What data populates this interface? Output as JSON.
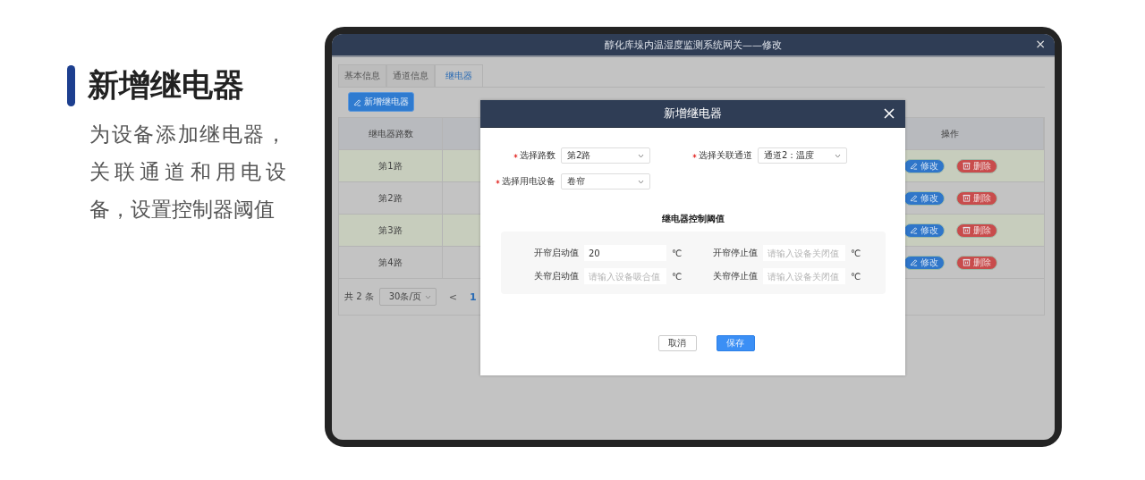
{
  "slide": {
    "title": "新增继电器",
    "description": "为设备添加继电器，关联通道和用电设备，设置控制器阈值"
  },
  "window": {
    "title": "醇化库垛内温湿度监测系统网关——修改",
    "close": "×"
  },
  "tabs": [
    {
      "label": "基本信息",
      "selected": false
    },
    {
      "label": "通道信息",
      "selected": false
    },
    {
      "label": "继电器",
      "selected": true
    }
  ],
  "add_button": "新增继电器",
  "table": {
    "columns": [
      "继电器路数",
      "操作"
    ],
    "rows": [
      {
        "column_1": "第1路",
        "actions": [
          {
            "kind": "edit",
            "label": "修改"
          },
          {
            "kind": "delete",
            "label": "删除"
          }
        ]
      },
      {
        "column_1": "第2路",
        "actions": [
          {
            "kind": "edit",
            "label": "修改"
          },
          {
            "kind": "delete",
            "label": "删除"
          }
        ]
      },
      {
        "column_1": "第3路",
        "actions": [
          {
            "kind": "edit",
            "label": "修改"
          },
          {
            "kind": "delete",
            "label": "删除"
          }
        ]
      },
      {
        "column_1": "第4路",
        "actions": [
          {
            "kind": "edit",
            "label": "修改"
          },
          {
            "kind": "delete",
            "label": "删除"
          }
        ]
      }
    ]
  },
  "pagination": {
    "total": "共 2 条",
    "page_size": "30条/页",
    "prev": "<",
    "pages": [
      {
        "label": "1",
        "selected": true
      }
    ]
  },
  "dialog": {
    "title": "新增继电器",
    "fields": [
      {
        "label": "选择路数",
        "required": true,
        "value": "第2路"
      },
      {
        "label": "选择关联通道",
        "required": true,
        "value": "通道2：温度"
      },
      {
        "label": "选择用电设备",
        "required": true,
        "value": "卷帘"
      }
    ],
    "section_title": "继电器控制阈值",
    "thresholds": [
      {
        "label": "开帘启动值",
        "value": "20",
        "unit": "℃"
      },
      {
        "label": "开帘停止值",
        "placeholder": "请输入设备关闭值",
        "unit": "℃"
      },
      {
        "label": "关帘启动值",
        "placeholder": "请输入设备吸合值",
        "unit": "℃"
      },
      {
        "label": "关帘停止值",
        "placeholder": "请输入设备关闭值",
        "unit": "℃"
      }
    ],
    "buttons": [
      {
        "kind": "secondary",
        "label": "取消"
      },
      {
        "kind": "primary",
        "label": "保存"
      }
    ]
  }
}
